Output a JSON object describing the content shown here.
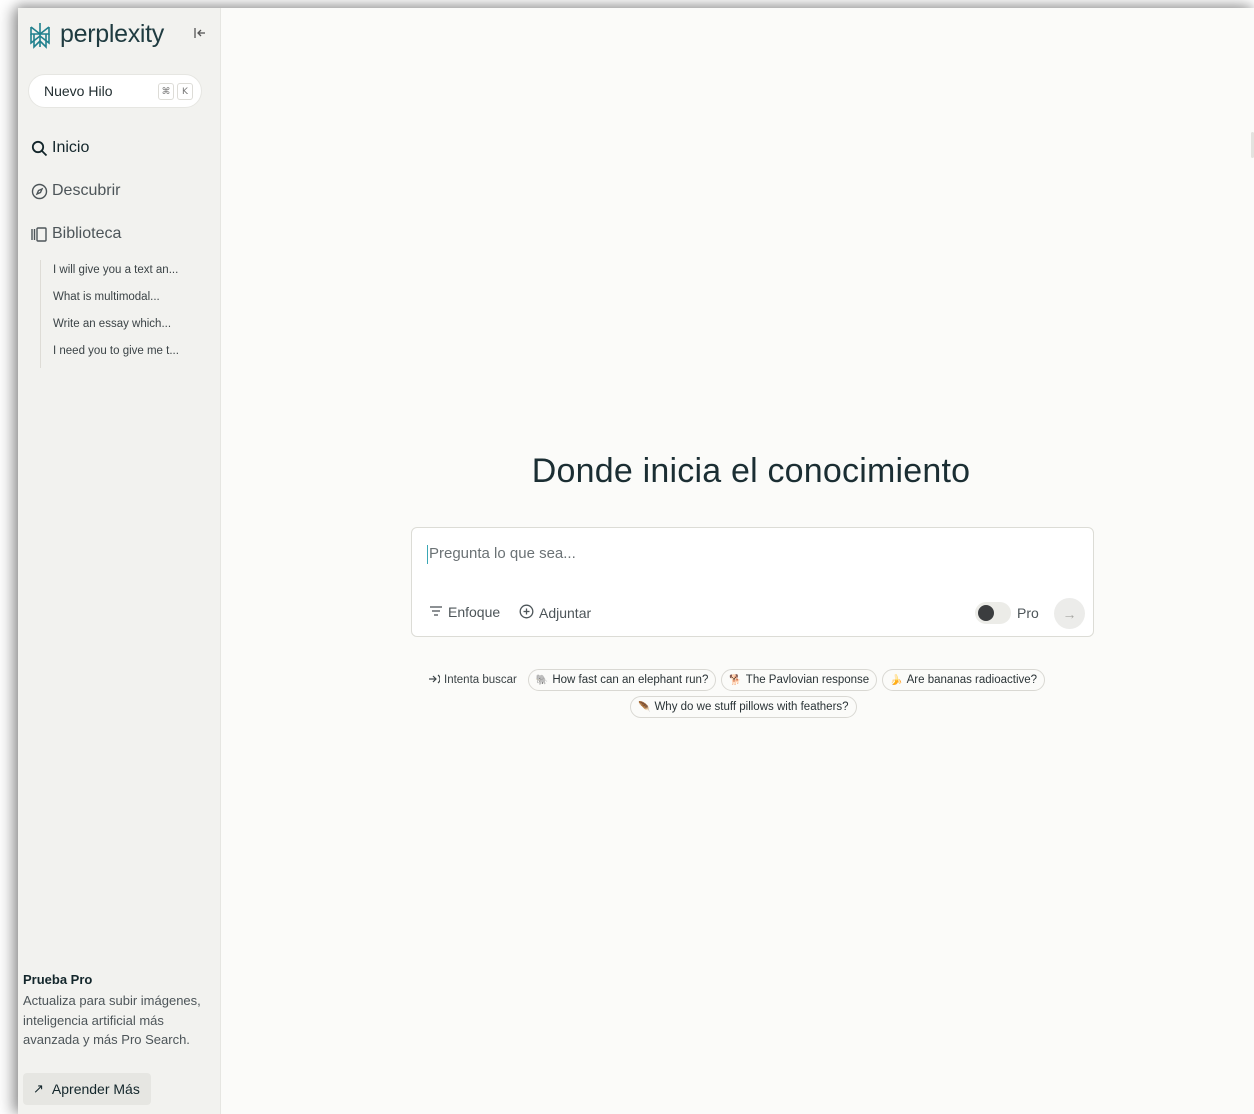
{
  "app": {
    "logo_text": "perplexity",
    "accent_color": "#20808d"
  },
  "sidebar": {
    "collapse_icon": "collapse-left-icon",
    "new_thread": {
      "label": "Nuevo Hilo",
      "shortcut": [
        "⌘",
        "K"
      ]
    },
    "nav": [
      {
        "label": "Inicio",
        "icon": "search-icon",
        "active": true
      },
      {
        "label": "Descubrir",
        "icon": "compass-icon",
        "active": false
      },
      {
        "label": "Biblioteca",
        "icon": "library-icon",
        "active": false
      }
    ],
    "threads": [
      "I will give you a text an...",
      "What is multimodal...",
      "Write an essay which...",
      "I need you to give me t..."
    ],
    "promo": {
      "title": "Prueba Pro",
      "text": "Actualiza para subir imágenes, inteligencia artificial más avanzada y más Pro Search.",
      "button": "Aprender Más"
    }
  },
  "main": {
    "headline": "Donde inicia el conocimiento",
    "search": {
      "placeholder": "Pregunta lo que sea...",
      "value": "",
      "focus_label": "Enfoque",
      "attach_label": "Adjuntar",
      "pro_label": "Pro",
      "pro_enabled": false
    },
    "suggestions": {
      "label": "Intenta buscar",
      "items": [
        {
          "emoji": "🐘",
          "text": "How fast can an elephant run?"
        },
        {
          "emoji": "🐕",
          "text": "The Pavlovian response"
        },
        {
          "emoji": "🍌",
          "text": "Are bananas radioactive?"
        },
        {
          "emoji": "🪶",
          "text": "Why do we stuff pillows with feathers?"
        }
      ]
    }
  }
}
